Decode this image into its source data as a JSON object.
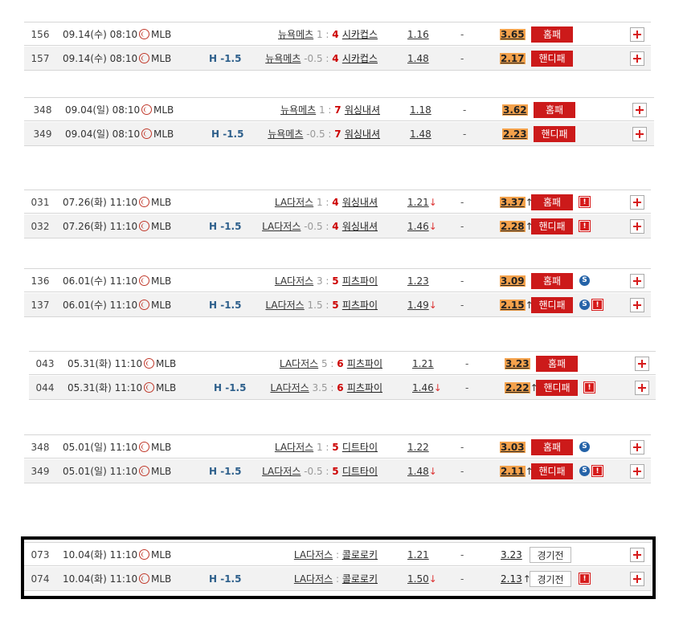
{
  "league_name": "MLB",
  "groups": [
    {
      "rows": [
        {
          "no": "156",
          "date": "09.14(수) 08:10",
          "hcap": "",
          "home": "뉴욕메츠",
          "hs": "1",
          "as": "4",
          "away": "시카컵스",
          "odd1": "1.16",
          "odd1_arrow": "",
          "dash": "-",
          "odd2": "3.65",
          "odd2_arrow": "",
          "result": "홈패",
          "badges": []
        },
        {
          "no": "157",
          "date": "09.14(수) 08:10",
          "hcap": "H -1.5",
          "home": "뉴욕메츠",
          "hs": "-0.5",
          "as": "4",
          "away": "시카컵스",
          "odd1": "1.48",
          "odd1_arrow": "",
          "dash": "-",
          "odd2": "2.17",
          "odd2_arrow": "",
          "result": "핸디패",
          "badges": []
        }
      ]
    },
    {
      "rows": [
        {
          "no": "348",
          "date": "09.04(일) 08:10",
          "hcap": "",
          "home": "뉴욕메츠",
          "hs": "1",
          "as": "7",
          "away": "워싱내셔",
          "odd1": "1.18",
          "odd1_arrow": "",
          "dash": "-",
          "odd2": "3.62",
          "odd2_arrow": "",
          "result": "홈패",
          "badges": []
        },
        {
          "no": "349",
          "date": "09.04(일) 08:10",
          "hcap": "H -1.5",
          "home": "뉴욕메츠",
          "hs": "-0.5",
          "as": "7",
          "away": "워싱내셔",
          "odd1": "1.48",
          "odd1_arrow": "",
          "dash": "-",
          "odd2": "2.23",
          "odd2_arrow": "",
          "result": "핸디패",
          "badges": []
        }
      ]
    },
    {
      "rows": [
        {
          "no": "031",
          "date": "07.26(화) 11:10",
          "hcap": "",
          "home": "LA다저스",
          "hs": "1",
          "as": "4",
          "away": "워싱내셔",
          "odd1": "1.21",
          "odd1_arrow": "↓",
          "dash": "-",
          "odd2": "3.37",
          "odd2_arrow": "↑",
          "result": "홈패",
          "badges": [
            "!"
          ]
        },
        {
          "no": "032",
          "date": "07.26(화) 11:10",
          "hcap": "H -1.5",
          "home": "LA다저스",
          "hs": "-0.5",
          "as": "4",
          "away": "워싱내셔",
          "odd1": "1.46",
          "odd1_arrow": "↓",
          "dash": "-",
          "odd2": "2.28",
          "odd2_arrow": "↑",
          "result": "핸디패",
          "badges": [
            "!"
          ]
        }
      ]
    },
    {
      "rows": [
        {
          "no": "136",
          "date": "06.01(수) 11:10",
          "hcap": "",
          "home": "LA다저스",
          "hs": "3",
          "as": "5",
          "away": "피츠파이",
          "odd1": "1.23",
          "odd1_arrow": "",
          "dash": "-",
          "odd2": "3.09",
          "odd2_arrow": "",
          "result": "홈패",
          "badges": [
            "S"
          ]
        },
        {
          "no": "137",
          "date": "06.01(수) 11:10",
          "hcap": "H -1.5",
          "home": "LA다저스",
          "hs": "1.5",
          "as": "5",
          "away": "피츠파이",
          "odd1": "1.49",
          "odd1_arrow": "↓",
          "dash": "-",
          "odd2": "2.15",
          "odd2_arrow": "↑",
          "result": "핸디패",
          "badges": [
            "S",
            "!"
          ]
        }
      ]
    },
    {
      "rows": [
        {
          "no": "043",
          "date": "05.31(화) 11:10",
          "hcap": "",
          "home": "LA다저스",
          "hs": "5",
          "as": "6",
          "away": "피츠파이",
          "odd1": "1.21",
          "odd1_arrow": "",
          "dash": "-",
          "odd2": "3.23",
          "odd2_arrow": "",
          "result": "홈패",
          "badges": []
        },
        {
          "no": "044",
          "date": "05.31(화) 11:10",
          "hcap": "H -1.5",
          "home": "LA다저스",
          "hs": "3.5",
          "as": "6",
          "away": "피츠파이",
          "odd1": "1.46",
          "odd1_arrow": "↓",
          "dash": "-",
          "odd2": "2.22",
          "odd2_arrow": "↑",
          "result": "핸디패",
          "badges": [
            "!"
          ]
        }
      ]
    },
    {
      "rows": [
        {
          "no": "348",
          "date": "05.01(일) 11:10",
          "hcap": "",
          "home": "LA다저스",
          "hs": "1",
          "as": "5",
          "away": "디트타이",
          "odd1": "1.22",
          "odd1_arrow": "",
          "dash": "-",
          "odd2": "3.03",
          "odd2_arrow": "",
          "result": "홈패",
          "badges": [
            "S"
          ]
        },
        {
          "no": "349",
          "date": "05.01(일) 11:10",
          "hcap": "H -1.5",
          "home": "LA다저스",
          "hs": "-0.5",
          "as": "5",
          "away": "디트타이",
          "odd1": "1.48",
          "odd1_arrow": "↓",
          "dash": "-",
          "odd2": "2.11",
          "odd2_arrow": "↑",
          "result": "핸디패",
          "badges": [
            "S",
            "!"
          ]
        }
      ]
    },
    {
      "current": true,
      "rows": [
        {
          "no": "073",
          "date": "10.04(화) 11:10",
          "hcap": "",
          "home": "LA다저스",
          "hs": "",
          "as": "",
          "away": "콜로로키",
          "odd1": "1.21",
          "odd1_arrow": "",
          "dash": "-",
          "odd2": "3.23",
          "odd2_arrow": "",
          "result": "경기전",
          "badges": []
        },
        {
          "no": "074",
          "date": "10.04(화) 11:10",
          "hcap": "H -1.5",
          "home": "LA다저스",
          "hs": "",
          "as": "",
          "away": "콜로로키",
          "odd1": "1.50",
          "odd1_arrow": "↓",
          "dash": "-",
          "odd2": "2.13",
          "odd2_arrow": "↑",
          "result": "경기전",
          "badges": [
            "!"
          ]
        }
      ]
    }
  ]
}
